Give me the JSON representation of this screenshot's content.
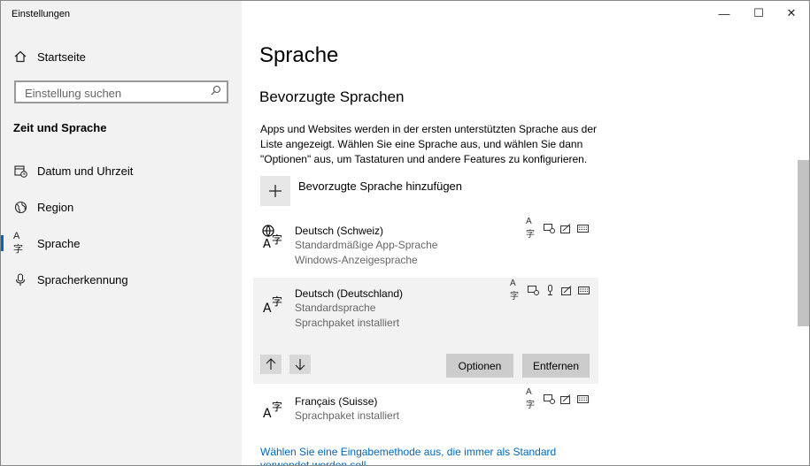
{
  "window": {
    "title": "Einstellungen",
    "minimize_glyph": "—",
    "maximize_glyph": "☐",
    "close_glyph": "✕"
  },
  "sidebar": {
    "home": {
      "label": "Startseite",
      "icon": "home-icon"
    },
    "search": {
      "placeholder": "Einstellung suchen",
      "value": "",
      "icon": "search-icon"
    },
    "section": "Zeit und Sprache",
    "items": [
      {
        "label": "Datum und Uhrzeit",
        "icon": "calendar-clock-icon",
        "active": false
      },
      {
        "label": "Region",
        "icon": "globe-icon",
        "active": false
      },
      {
        "label": "Sprache",
        "icon": "language-icon",
        "active": true
      },
      {
        "label": "Spracherkennung",
        "icon": "microphone-icon",
        "active": false
      }
    ],
    "accent_color": "#0067c0"
  },
  "main": {
    "title": "Sprache",
    "subtitle": "Bevorzugte Sprachen",
    "description": "Apps und Websites werden in der ersten unterstützten Sprache aus der Liste angezeigt. Wählen Sie eine Sprache aus, und wählen Sie dann \"Optionen\" aus, um Tastaturen und andere Features zu konfigurieren.",
    "add_language": {
      "label": "Bevorzugte Sprache hinzufügen",
      "icon": "plus-icon"
    },
    "languages": [
      {
        "name": "Deutsch (Schweiz)",
        "details": [
          "Standardmäßige App-Sprache",
          "Windows-Anzeigesprache"
        ],
        "features": [
          "language-pack-icon",
          "speech-icon",
          "handwriting-icon",
          "keyboard-icon"
        ]
      },
      {
        "name": "Deutsch (Deutschland)",
        "details": [
          "Standardsprache",
          "Sprachpaket installiert"
        ],
        "features": [
          "language-pack-icon",
          "speech-icon",
          "microphone-icon",
          "handwriting-icon",
          "keyboard-icon"
        ],
        "selected": true,
        "options_button": "Optionen",
        "remove_button": "Entfernen"
      },
      {
        "name": "Français (Suisse)",
        "details": [
          "Sprachpaket installiert"
        ],
        "features": [
          "language-pack-icon",
          "speech-icon",
          "handwriting-icon",
          "keyboard-icon"
        ]
      }
    ],
    "link_text": "Wählen Sie eine Eingabemethode aus, die immer als Standard verwendet werden soll"
  }
}
